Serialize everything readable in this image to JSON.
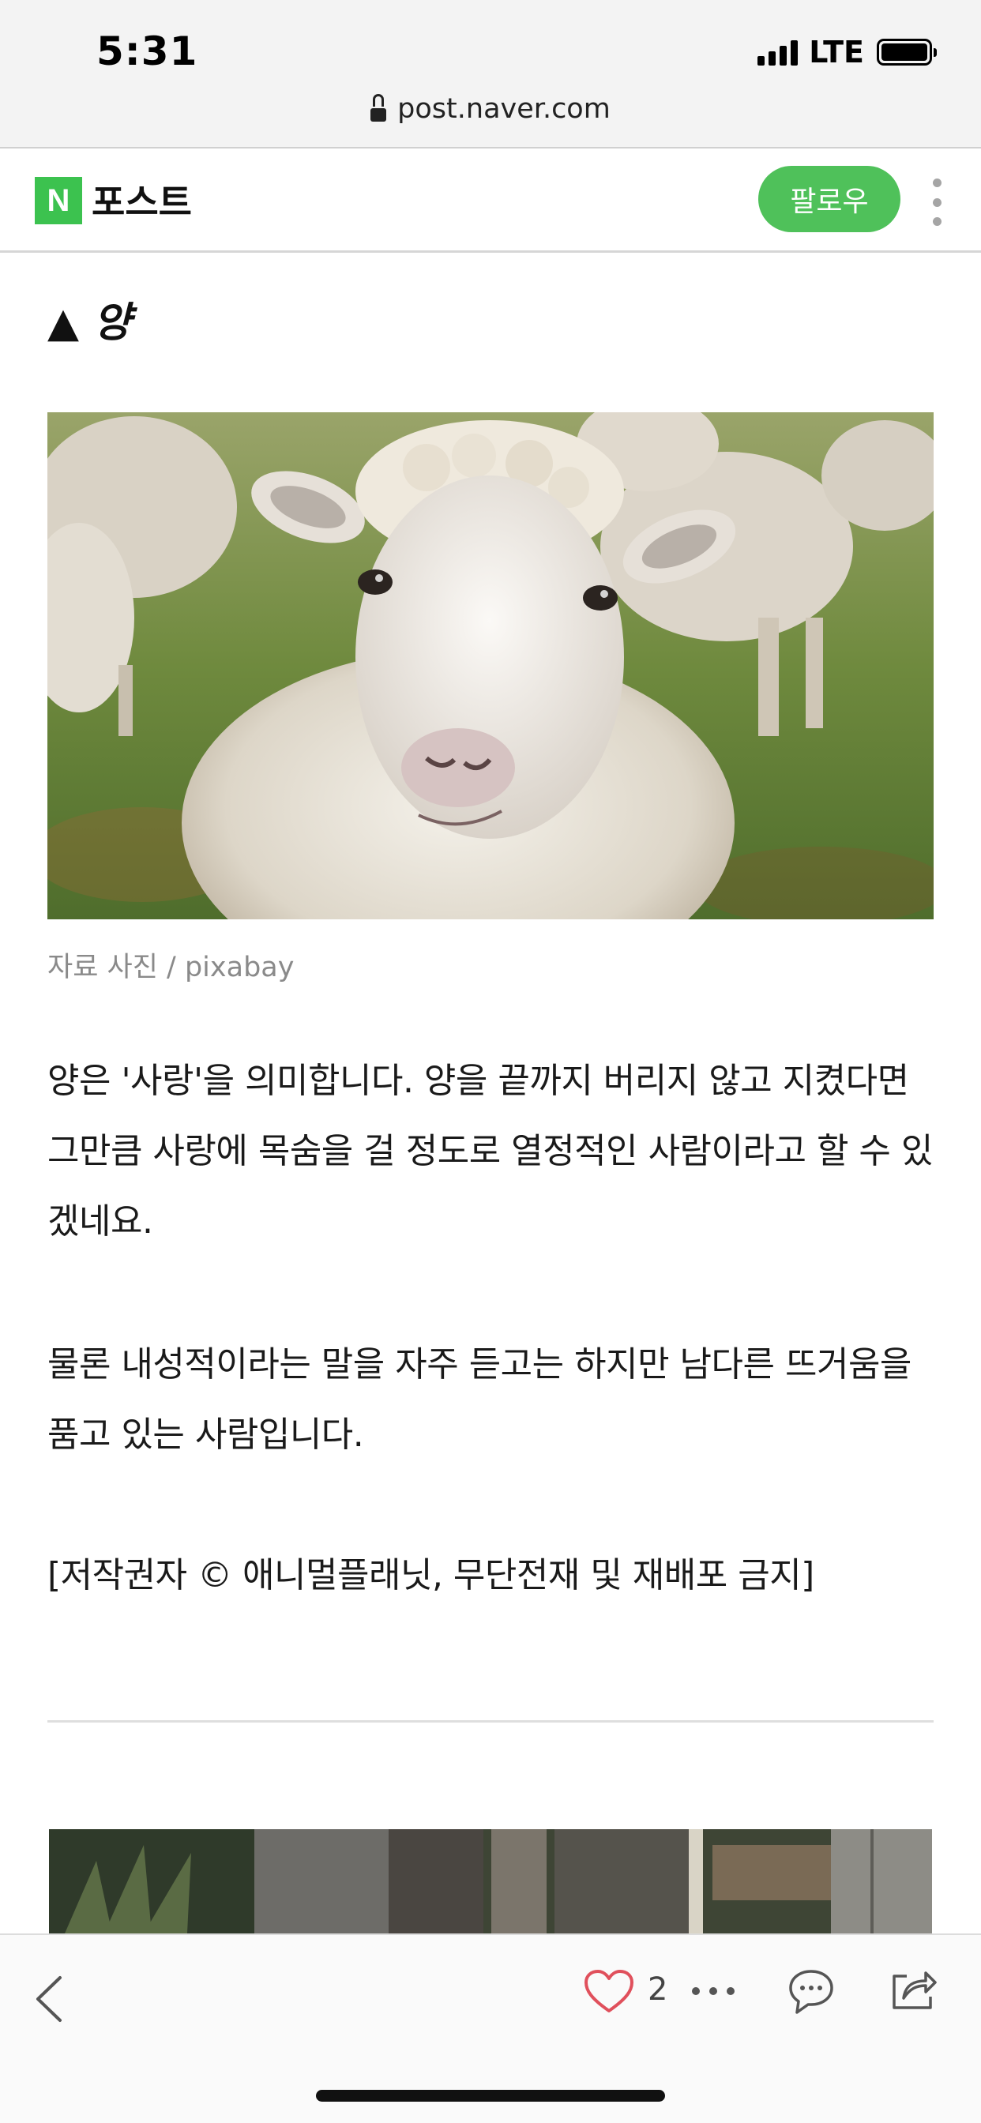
{
  "status_bar": {
    "time": "5:31",
    "network": "LTE"
  },
  "browser": {
    "url": "post.naver.com"
  },
  "header": {
    "logo_letter": "N",
    "title": "포스트",
    "follow_label": "팔로우"
  },
  "article": {
    "heading": "▲ 양",
    "image_caption": "자료 사진 / pixabay",
    "paragraphs": [
      "양은 '사랑'을 의미합니다. 양을 끝까지 버리지 않고 지켰다면 그만큼 사랑에 목숨을 걸 정도로 열정적인 사람이라고 할 수 있겠네요.",
      "물론 내성적이라는 말을 자주 듣고는 하지만 남다른 뜨거움을 품고 있는 사람입니다.",
      "[저작권자 © 애니멀플래닛, 무단전재 및 재배포 금지]"
    ]
  },
  "toolbar": {
    "like_count": "2"
  },
  "colors": {
    "naver_green": "#3cc24f",
    "follow_green": "#4fc15a",
    "like_heart": "#e0505c"
  },
  "icons": [
    "lock-icon",
    "more-vertical-icon",
    "back-chevron-icon",
    "heart-icon",
    "more-horizontal-icon",
    "comment-icon",
    "share-icon"
  ]
}
